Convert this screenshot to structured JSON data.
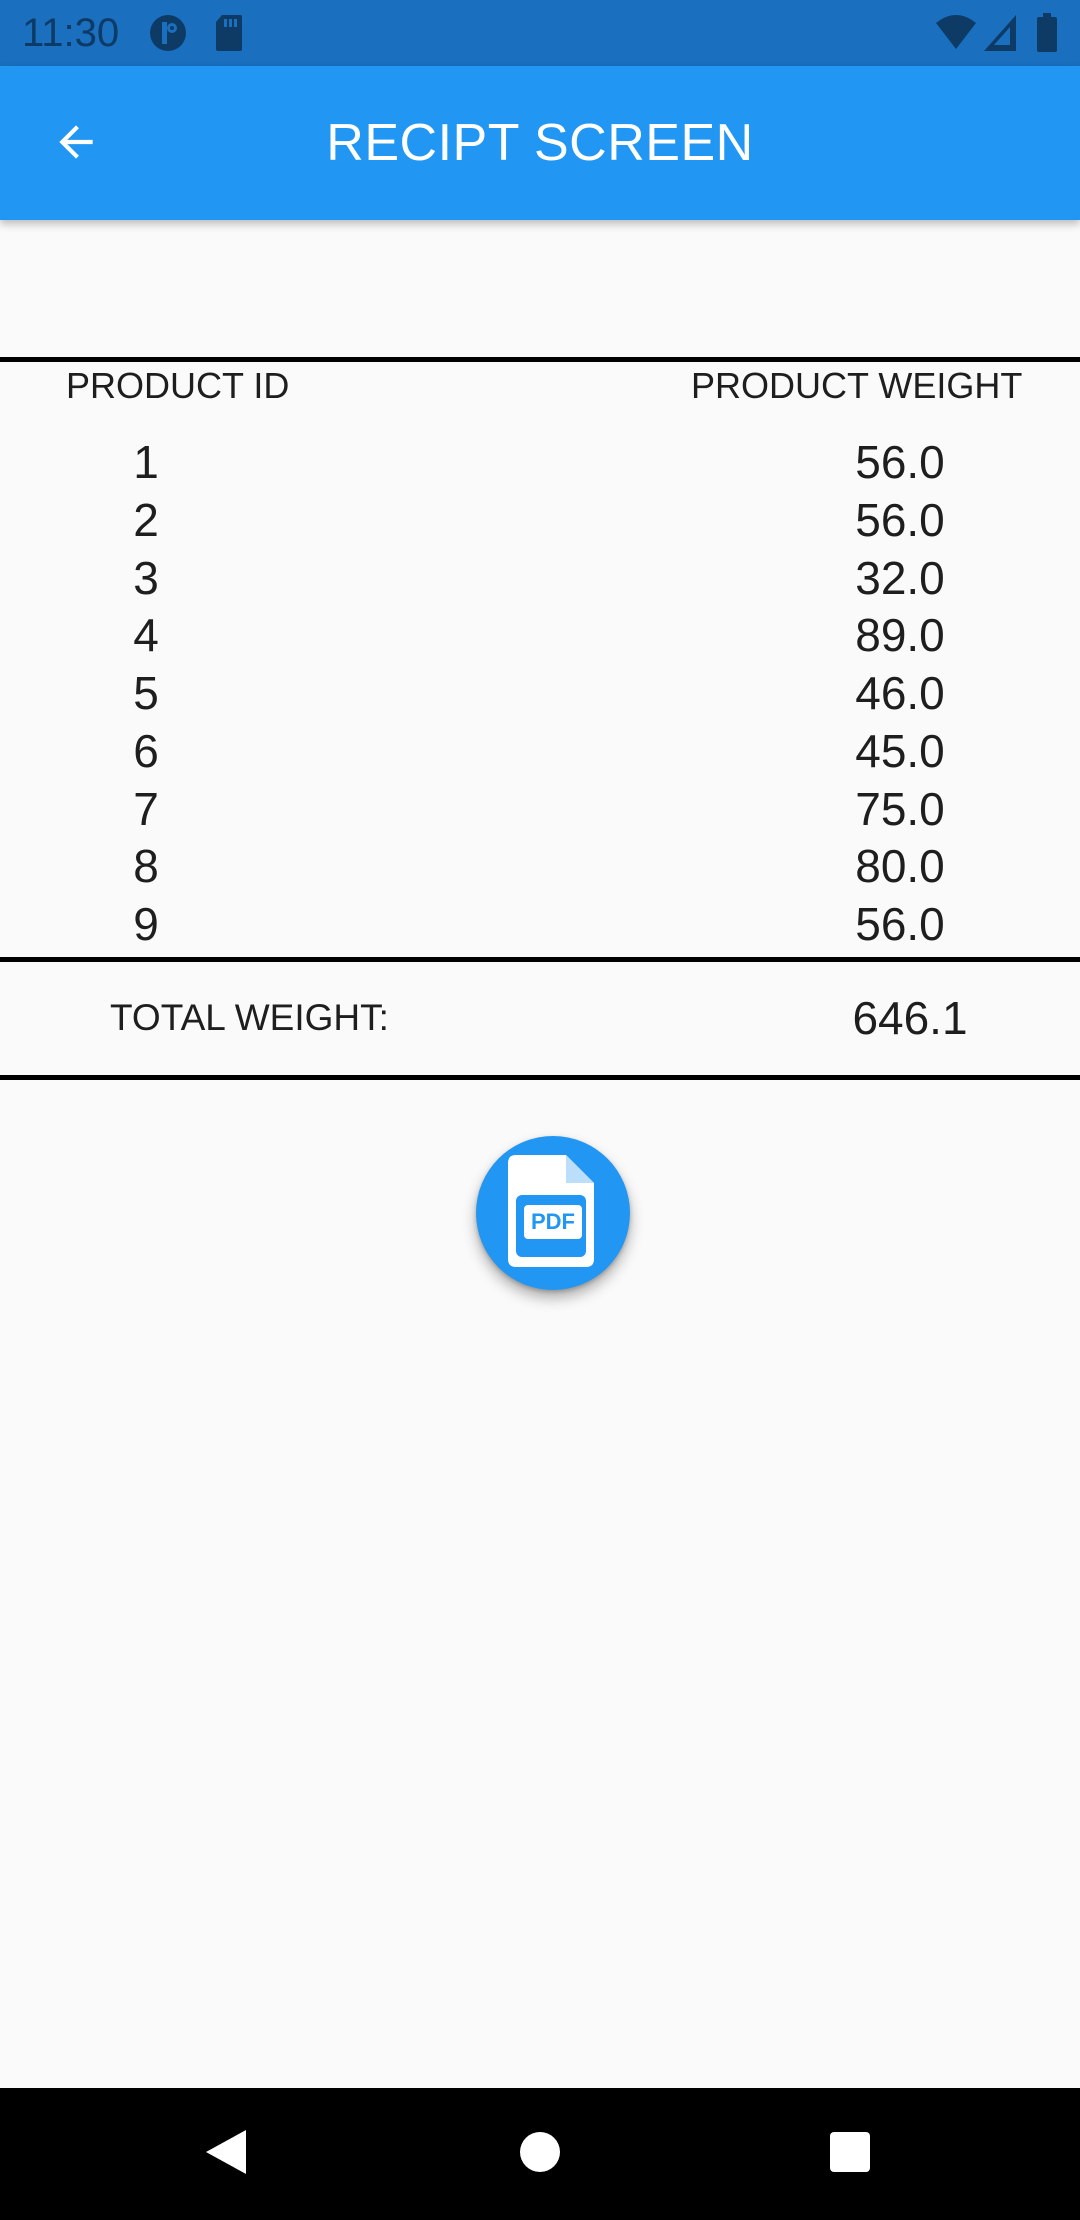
{
  "status_bar": {
    "time": "11:30",
    "icons": [
      "vpn-key-icon",
      "sd-card-icon",
      "wifi-icon",
      "signal-icon",
      "battery-icon"
    ]
  },
  "app_bar": {
    "title": "RECIPT SCREEN",
    "back_icon": "arrow-back-icon",
    "color": "#2196f3"
  },
  "table": {
    "headers": {
      "id": "PRODUCT ID",
      "weight": "PRODUCT WEIGHT"
    },
    "rows": [
      {
        "id": "1",
        "weight": "56.0"
      },
      {
        "id": "2",
        "weight": "56.0"
      },
      {
        "id": "3",
        "weight": "32.0"
      },
      {
        "id": "4",
        "weight": "89.0"
      },
      {
        "id": "5",
        "weight": "46.0"
      },
      {
        "id": "6",
        "weight": "45.0"
      },
      {
        "id": "7",
        "weight": "75.0"
      },
      {
        "id": "8",
        "weight": "80.0"
      },
      {
        "id": "9",
        "weight": "56.0"
      }
    ],
    "total_label": "TOTAL WEIGHT:",
    "total_value": "646.1"
  },
  "fab": {
    "icon": "pdf-file-icon",
    "icon_text": "PDF",
    "color": "#2196f3"
  },
  "nav_bar": {
    "buttons": [
      "back-triangle-icon",
      "home-circle-icon",
      "recents-square-icon"
    ]
  }
}
